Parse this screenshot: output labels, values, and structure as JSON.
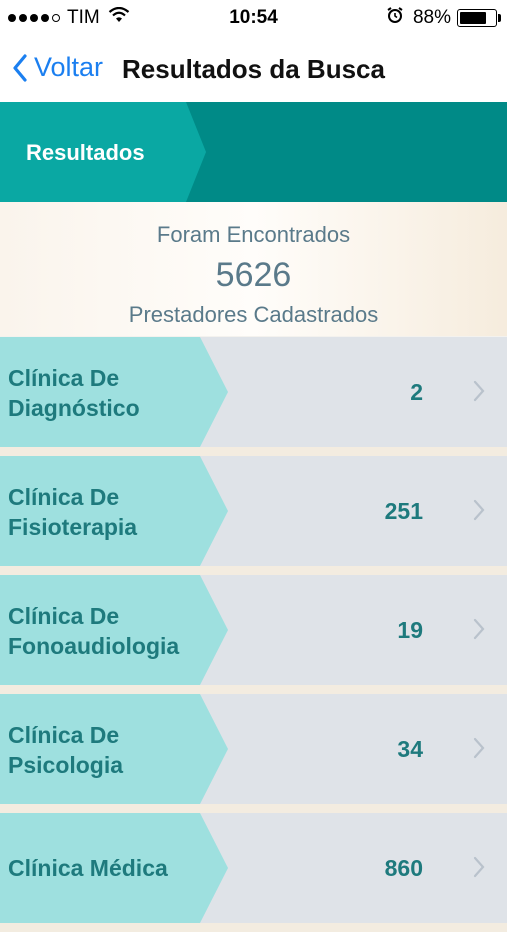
{
  "status_bar": {
    "carrier": "TIM",
    "time": "10:54",
    "battery": "88%",
    "battery_level": 0.88
  },
  "nav": {
    "back_label": "Voltar",
    "title": "Resultados da Busca"
  },
  "banner": {
    "tab_label": "Resultados"
  },
  "summary": {
    "line1": "Foram Encontrados",
    "count": "5626",
    "line3": "Prestadores Cadastrados"
  },
  "results": [
    {
      "line1": "Clínica De",
      "line2": "Diagnóstico",
      "count": "2"
    },
    {
      "line1": "Clínica De",
      "line2": "Fisioterapia",
      "count": "251"
    },
    {
      "line1": "Clínica De",
      "line2": "Fonoaudiologia",
      "count": "19"
    },
    {
      "line1": "Clínica De",
      "line2": "Psicologia",
      "count": "34"
    },
    {
      "line1": "Clínica Médica",
      "count": "860"
    }
  ],
  "colors": {
    "accent": "#1b7ff0",
    "teal_dark": "#008a87",
    "teal": "#0aa8a3",
    "label_bg": "#9ee0df",
    "text_teal": "#1e7a7d"
  }
}
